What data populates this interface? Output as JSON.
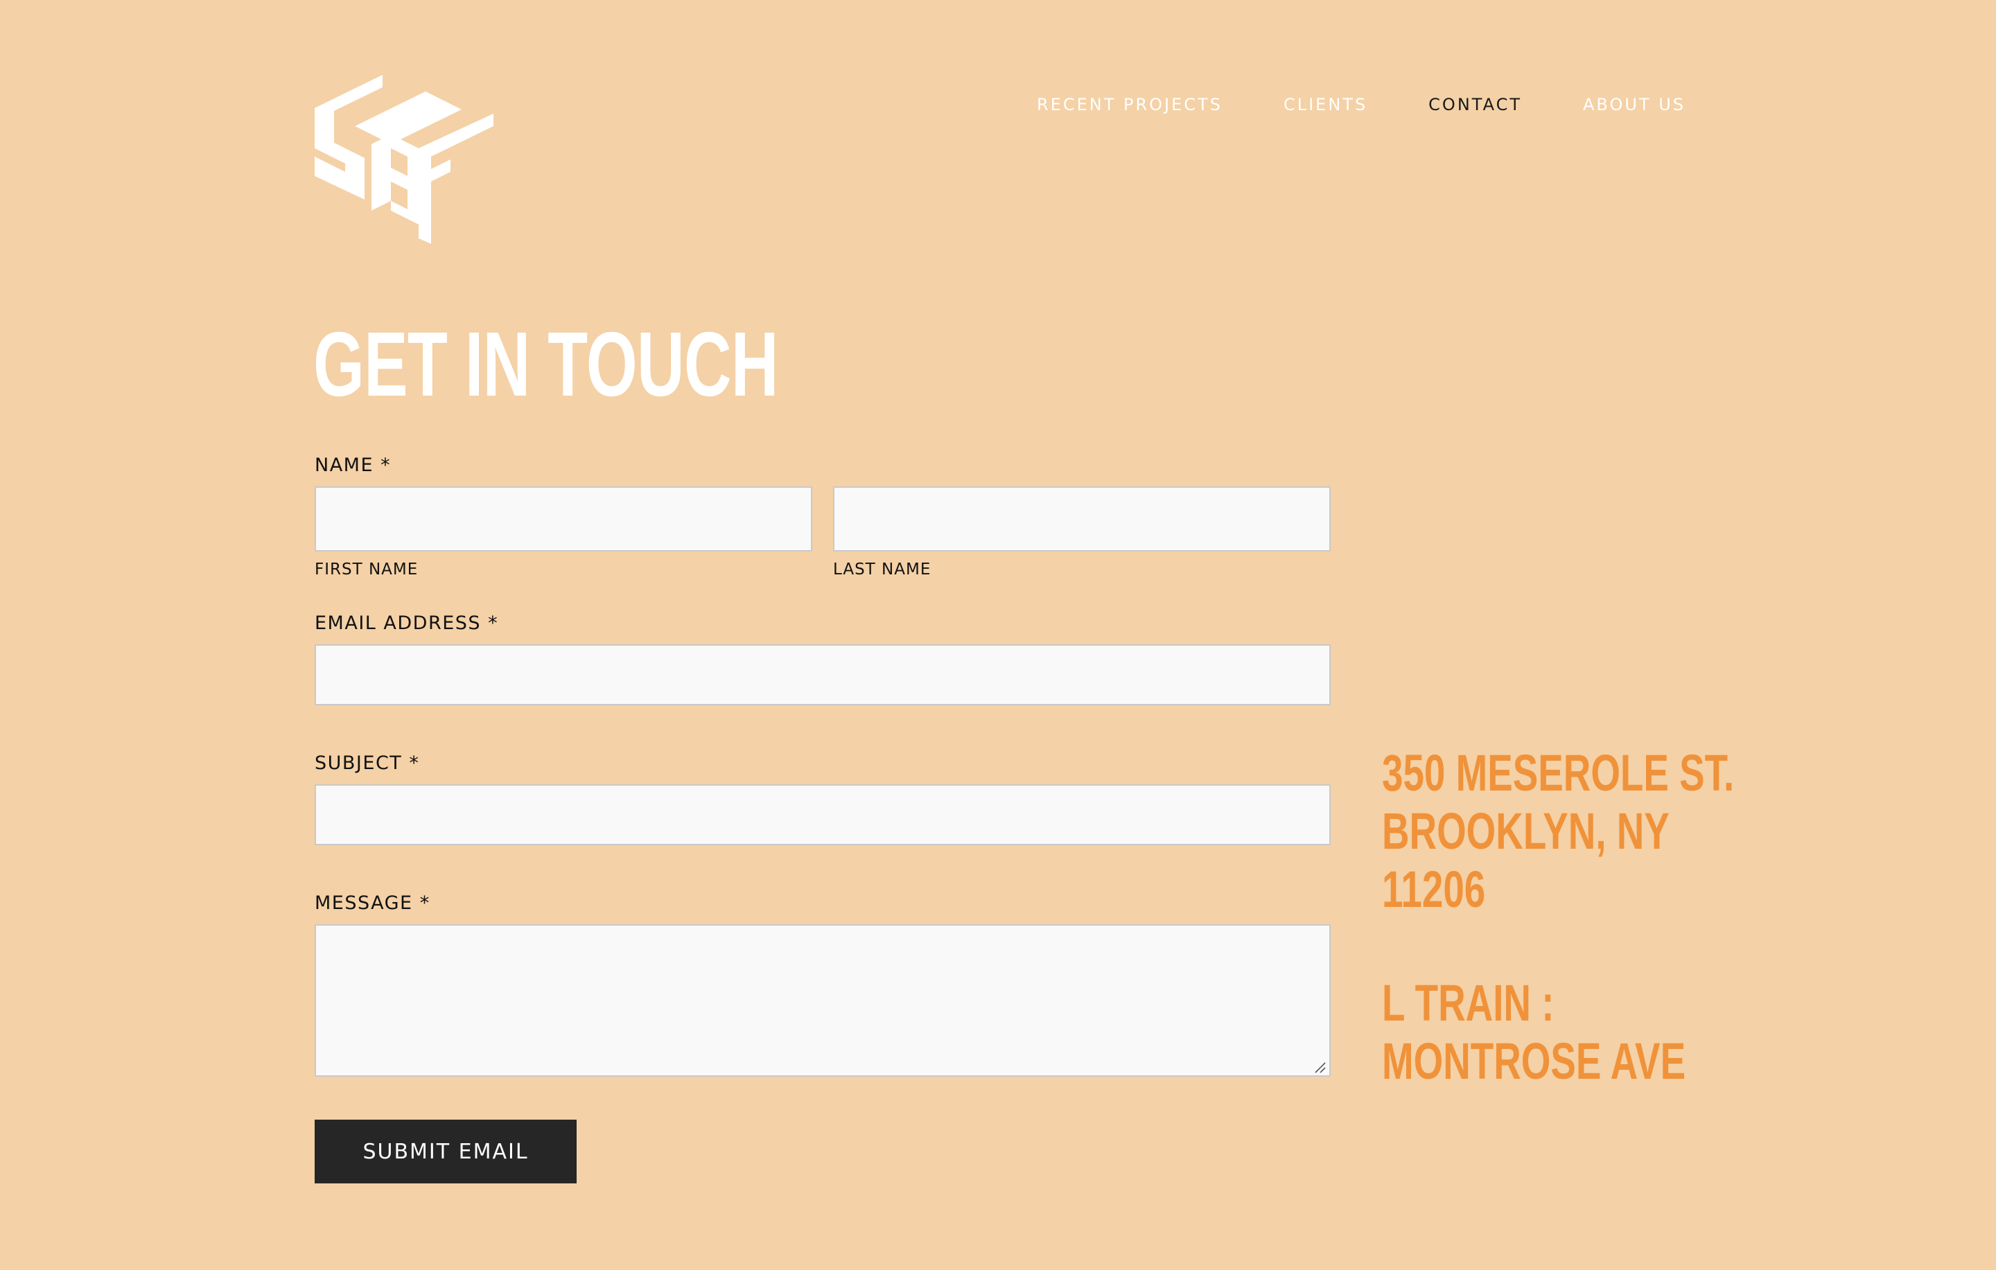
{
  "nav": {
    "items": [
      {
        "label": "RECENT PROJECTS",
        "active": false
      },
      {
        "label": "CLIENTS",
        "active": false
      },
      {
        "label": "CONTACT",
        "active": true
      },
      {
        "label": "ABOUT US",
        "active": false
      }
    ]
  },
  "heading": "GET IN TOUCH",
  "form": {
    "name_label": "NAME *",
    "first_name_label": "FIRST NAME",
    "last_name_label": "LAST NAME",
    "first_name_value": "",
    "last_name_value": "",
    "email_label": "EMAIL ADDRESS *",
    "email_value": "",
    "subject_label": "SUBJECT *",
    "subject_value": "",
    "message_label": "MESSAGE *",
    "message_value": "",
    "submit_label": "SUBMIT EMAIL"
  },
  "address": {
    "street": "350 MESEROLE ST.",
    "city": "BROOKLYN, NY",
    "zip": "11206",
    "train_line": "L TRAIN :",
    "train_stop": "MONTROSE AVE"
  },
  "icons": {
    "logo": "logo-icon",
    "resize": "resize-handle-icon"
  },
  "colors": {
    "background": "#f4d1a6",
    "accent": "#f0923a",
    "button": "#262626",
    "nav_text": "#ffffff",
    "nav_active": "#1a1a1a",
    "input_bg": "#f9f9f9"
  }
}
